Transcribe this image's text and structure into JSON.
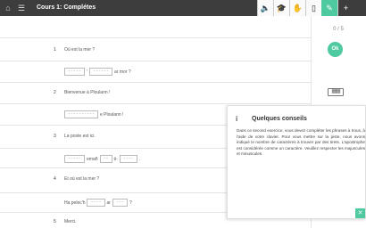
{
  "header": {
    "title": "Cours 1: Complétes",
    "home_icon": "home-icon",
    "menu_icon": "hamburger-menu-icon"
  },
  "toolbar": {
    "items": [
      {
        "name": "speaker-icon",
        "glyph": "🔈"
      },
      {
        "name": "graduation-cap-icon",
        "glyph": "🎓"
      },
      {
        "name": "hand-icon",
        "glyph": "✋"
      },
      {
        "name": "document-icon",
        "glyph": "▯"
      },
      {
        "name": "pencil-icon",
        "glyph": "✎"
      },
      {
        "name": "plus-icon",
        "glyph": "+"
      }
    ]
  },
  "exercise": {
    "q1": {
      "num": "1",
      "text": "Où est la mer ?",
      "blank1": "-----",
      "apos": "'",
      "blank2": "------",
      "tail": "ar mor ?"
    },
    "q2": {
      "num": "2",
      "text": "Bienvenue à Ploulann !",
      "blank1": "----------",
      "tail": "e Ploulann !"
    },
    "q3": {
      "num": "3",
      "text": "La poste est ici.",
      "blank1": "-----",
      "mid1": "emañ",
      "blank2": "--",
      "mid2": "ti-",
      "blank3": "----",
      "tail": "."
    },
    "q4": {
      "num": "4",
      "text": "Et où est la mer ?",
      "head": "Ha pelec'h",
      "blank1": "----",
      "mid": "ar",
      "blank2": "---",
      "tail": "?"
    },
    "q5": {
      "num": "5",
      "text": "Merci."
    }
  },
  "sidebar": {
    "score": "0 / 5",
    "ok_label": "Ok",
    "keyboard_icon": "keyboard-icon"
  },
  "tips": {
    "info_icon": "i",
    "title": "Quelques conseils",
    "text": "Dans ce second exercice, vous devez compléter les phrases à trous, à l'aide de votre clavier. Pour vous mettre sur la piste, nous avons indiqué le nombre de caractères à trouver par des tirets. L'apostrophe est considérée comme un caractère. Veuillez respecter les majuscules et minuscules.",
    "close_glyph": "✕"
  }
}
